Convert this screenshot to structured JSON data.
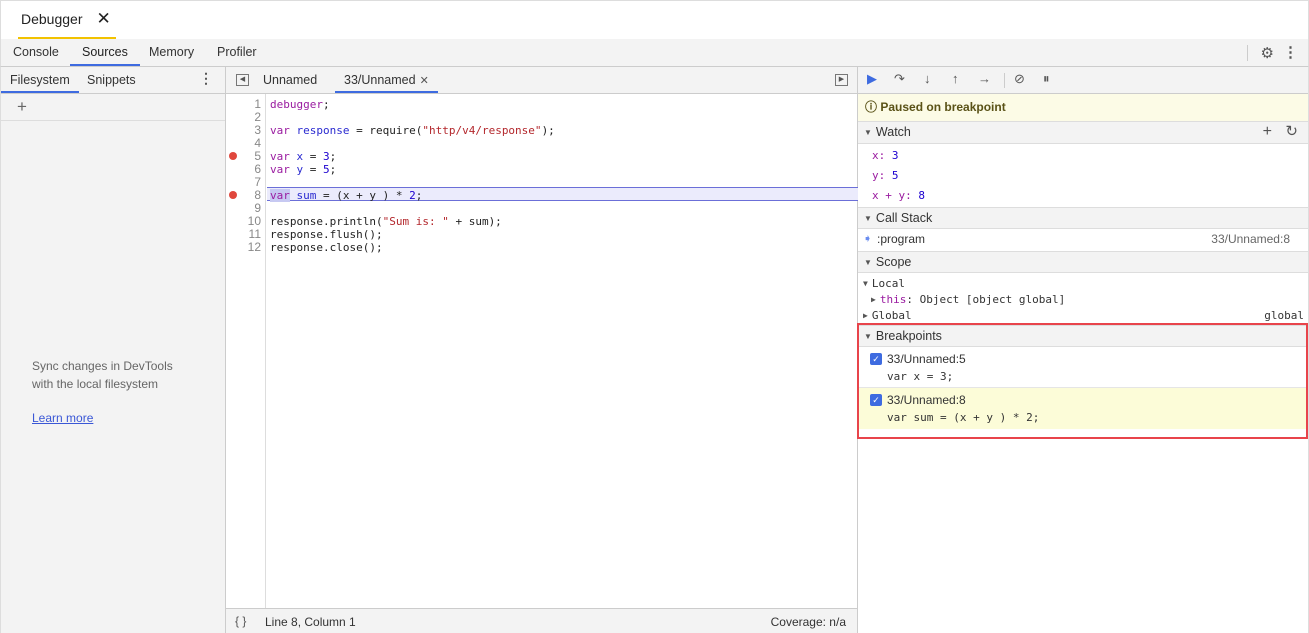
{
  "window": {
    "tab_title": "Debugger",
    "close_glyph": "✕"
  },
  "main_tabs": [
    "Console",
    "Sources",
    "Memory",
    "Profiler"
  ],
  "main_active": "Sources",
  "icons": {
    "gear": "⚙",
    "kebab": "⋮",
    "plus": "+",
    "refresh": "↻",
    "close": "✕",
    "triangle_down": "▼",
    "triangle_right": "▶",
    "info": "ⓘ",
    "arrow": "➧",
    "check": "✓",
    "braces": "{ }"
  },
  "left": {
    "tabs": [
      "Filesystem",
      "Snippets"
    ],
    "active": "Filesystem",
    "sync_line1": "Sync changes in DevTools",
    "sync_line2": "with the local filesystem",
    "learn_more": "Learn more"
  },
  "editor": {
    "tabs": [
      "Unnamed",
      "33/Unnamed"
    ],
    "active": "33/Unnamed",
    "line_numbers": [
      "1",
      "2",
      "3",
      "4",
      "5",
      "6",
      "7",
      "8",
      "9",
      "10",
      "11",
      "12"
    ],
    "breakpoint_lines": [
      5,
      8
    ],
    "current_line": 8,
    "status_position": "Line 8, Column 1",
    "coverage": "Coverage: n/a"
  },
  "debugger": {
    "paused_message": "Paused on breakpoint",
    "watch_title": "Watch",
    "watch": [
      {
        "name": "x",
        "value": "3"
      },
      {
        "name": "y",
        "value": "5"
      },
      {
        "name": "x + y",
        "value": "8"
      }
    ],
    "callstack_title": "Call Stack",
    "callstack": [
      {
        "name": ":program",
        "location": "33/Unnamed:8"
      }
    ],
    "scope_title": "Scope",
    "scope_local": "Local",
    "scope_this_key": "this",
    "scope_this_val": ": Object [object global]",
    "scope_global": "Global",
    "scope_global_val": "global",
    "breakpoints_title": "Breakpoints",
    "breakpoints": [
      {
        "location": "33/Unnamed:5",
        "code": "var x = 3;",
        "checked": true
      },
      {
        "location": "33/Unnamed:8",
        "code": "var sum = (x + y ) * 2;",
        "checked": true
      }
    ]
  }
}
